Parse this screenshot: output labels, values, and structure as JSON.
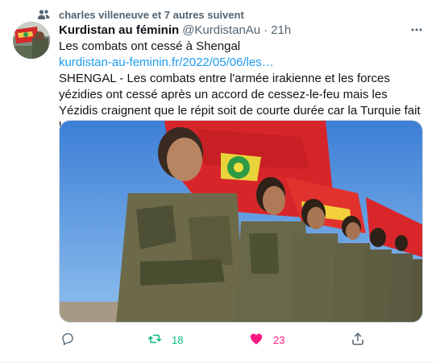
{
  "social_context": {
    "text": "charles villeneuve et 7 autres suivent"
  },
  "tweet": {
    "display_name": "Kurdistan au féminin",
    "handle": "@KurdistanAu",
    "separator": "·",
    "time": "21h",
    "headline": "Les combats ont cessé à Shengal",
    "link": "kurdistan-au-feminin.fr/2022/05/06/les…",
    "text": "SHENGAL - Les combats entre l'armée irakienne et les forces yézidies ont cessé après un accord de cessez-le-feu mais les Yézidis craignent que le répit soit de courte durée car la Turquie fait la pression sur le gouve…"
  },
  "actions": {
    "retweets": "18",
    "likes": "23"
  },
  "colors": {
    "retweet_active": "#00ba7c",
    "like_active": "#f91880",
    "link": "#1d9bf0",
    "secondary_text": "#536471"
  },
  "icons": {
    "social_context": "users-icon",
    "more": "more-icon",
    "reply": "reply-icon",
    "retweet": "retweet-icon",
    "like": "heart-icon",
    "share": "share-icon"
  }
}
